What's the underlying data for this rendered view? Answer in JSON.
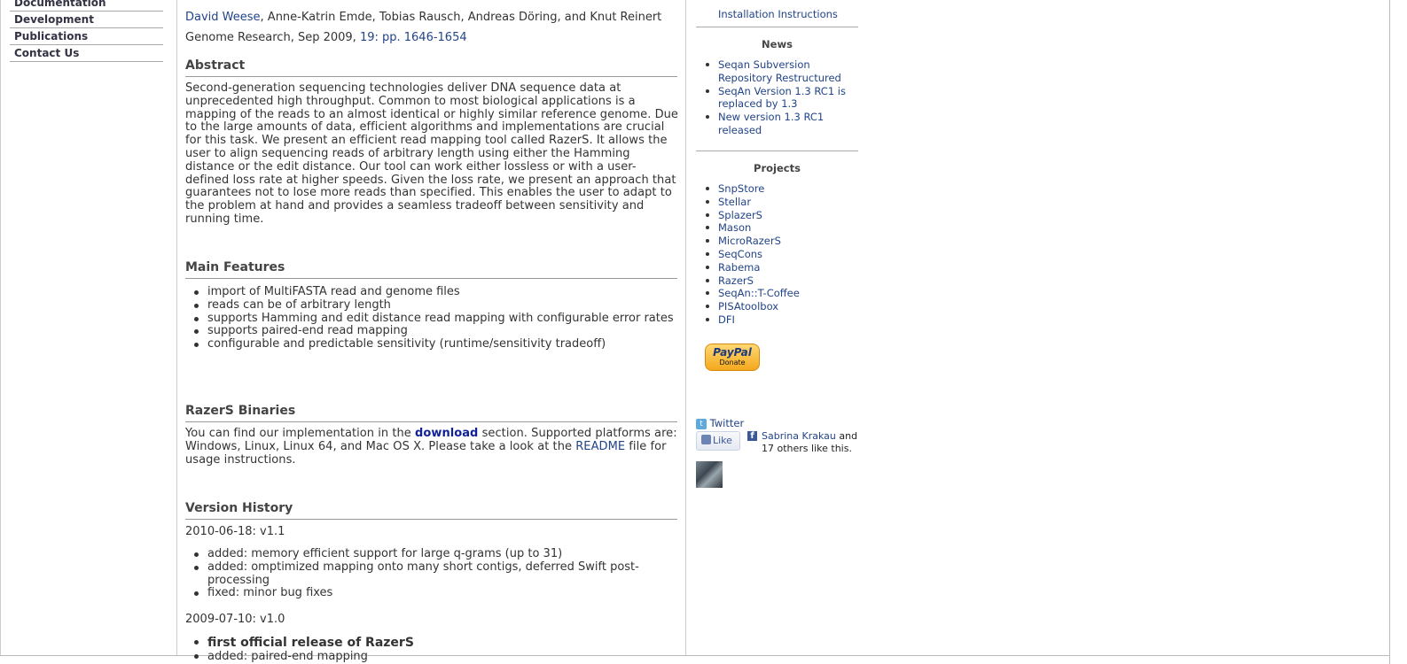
{
  "left_nav": {
    "items": [
      "Documentation",
      "Development",
      "Publications",
      "Contact Us"
    ]
  },
  "paper": {
    "first_author": "David Weese",
    "other_authors": ", Anne-Katrin Emde, Tobias Rausch, Andreas Döring, and Knut Reinert",
    "journal_text": "Genome Research, Sep 2009, ",
    "journal_link": "19: pp. 1646-1654"
  },
  "abstract": {
    "heading": "Abstract",
    "text": "Second-generation sequencing technologies deliver DNA sequence data at unprecedented high throughput. Common to most biological applications is a mapping of the reads to an almost identical or highly similar reference genome. Due to the large amounts of data, efficient algorithms and implementations are crucial for this task. We present an efficient read mapping tool called RazerS. It allows the user to align sequencing reads of arbitrary length using either the Hamming distance or the edit distance. Our tool can work either lossless or with a user-defined loss rate at higher speeds. Given the loss rate, we present an approach that guarantees not to lose more reads than specified. This enables the user to adapt to the problem at hand and provides a seamless tradeoff between sensitivity and running time."
  },
  "features": {
    "heading": "Main Features",
    "items": [
      "import of MultiFASTA read and genome files",
      "reads can be of arbitrary length",
      "supports Hamming and edit distance read mapping with configurable error rates",
      "supports paired-end read mapping",
      "configurable and predictable sensitivity (runtime/sensitivity tradeoff)"
    ]
  },
  "binaries": {
    "heading": "RazerS Binaries",
    "text_before": "You can find our implementation in the ",
    "download_link": "download",
    "text_middle": " section. Supported platforms are: Windows, Linux, Linux 64, and Mac OS X. Please take a look at the ",
    "readme_link": "README",
    "text_after": " file for usage instructions."
  },
  "history": {
    "heading": "Version History",
    "v11_label": "2010-06-18: v1.1",
    "v11_items": [
      "added: memory efficient support for large q-grams (up to 31)",
      "added: omptimized mapping onto many short contigs, deferred Swift post-processing",
      "fixed: minor bug fixes"
    ],
    "v10_label": "2009-07-10: v1.0",
    "v10_first": "first official release of RazerS",
    "v10_second": "added: paired-end mapping"
  },
  "sidebar": {
    "install_link": "Installation Instructions",
    "news_heading": "News",
    "news": [
      "Seqan Subversion Repository Restructured",
      "SeqAn Version 1.3 RC1 is replaced by 1.3",
      "New version 1.3 RC1 released"
    ],
    "projects_heading": "Projects",
    "projects": [
      "SnpStore",
      "Stellar",
      "SplazerS",
      "Mason",
      "MicroRazerS",
      "SeqCons",
      "Rabema",
      "RazerS",
      "SeqAn::T-Coffee",
      "PISAtoolbox",
      "DFI"
    ],
    "paypal_logo": "PayPal",
    "paypal_donate": "Donate",
    "twitter": "Twitter",
    "like": "Like",
    "fb_name": "Sabrina Krakau",
    "fb_rest": " and 17 others like this."
  }
}
